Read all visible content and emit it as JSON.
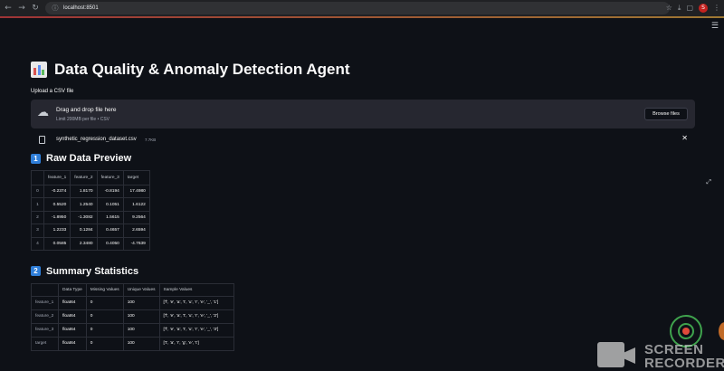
{
  "browser": {
    "url": "localhost:8501",
    "back_icon": "arrow-left-icon",
    "forward_icon": "arrow-right-icon",
    "reload_icon": "reload-icon",
    "profile_letter": "S"
  },
  "app": {
    "title": "Data Quality & Anomaly Detection Agent",
    "upload": {
      "label": "Upload a CSV file",
      "drop_title": "Drag and drop file here",
      "limit": "Limit 200MB per file • CSV",
      "browse_label": "Browse files",
      "file_name": "synthetic_regression_dataset.csv",
      "file_size": "7.7KB"
    },
    "preview": {
      "number": "1",
      "heading": "Raw Data Preview",
      "columns": [
        "",
        "feature_1",
        "feature_2",
        "feature_3",
        "target"
      ],
      "rows": [
        [
          "0",
          "-0.2374",
          "1.8170",
          "-0.8194",
          "17.4980"
        ],
        [
          "1",
          "0.5520",
          "1.2540",
          "0.1051",
          "1.6122"
        ],
        [
          "2",
          "-1.8950",
          "-1.3082",
          "1.5615",
          "9.2564"
        ],
        [
          "3",
          "1.2233",
          "0.1284",
          "0.4657",
          "2.6594"
        ],
        [
          "4",
          "0.0585",
          "2.3480",
          "0.4050",
          "-4.7639"
        ]
      ]
    },
    "summary": {
      "number": "2",
      "heading": "Summary Statistics",
      "columns": [
        "",
        "Data Type",
        "Missing Values",
        "Unique Values",
        "Sample Values"
      ],
      "rows": [
        [
          "feature_1",
          "float64",
          "0",
          "100",
          "['f', 'e', 'a', 't', 'u', 'r', 'e', '_', '1']"
        ],
        [
          "feature_2",
          "float64",
          "0",
          "100",
          "['f', 'e', 'a', 't', 'u', 'r', 'e', '_', '2']"
        ],
        [
          "feature_3",
          "float64",
          "0",
          "100",
          "['f', 'e', 'a', 't', 'u', 'r', 'e', '_', '3']"
        ],
        [
          "target",
          "float64",
          "0",
          "100",
          "['t', 'a', 'r', 'g', 'e', 't']"
        ]
      ]
    }
  },
  "watermark": {
    "line1": "SCREEN",
    "line2": "RECORDER"
  }
}
